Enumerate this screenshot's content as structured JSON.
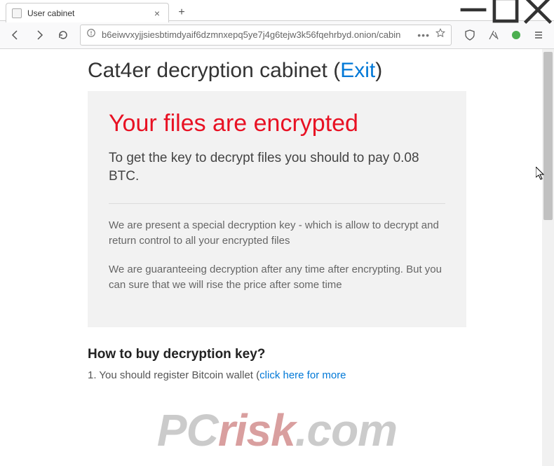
{
  "window": {
    "tab_title": "User cabinet",
    "url": "b6eiwvxyjjsiesbtimdyaif6dzmnxepq5ye7j4g6tejw3k56fqehrbyd.onion/cabin"
  },
  "page": {
    "title_prefix": "Cat4er decryption cabinet (",
    "exit_label": "Exit",
    "title_suffix": ")",
    "alert_heading": "Your files are encrypted",
    "alert_sub": "To get the key to decrypt files you should to pay 0.08 BTC.",
    "para1": "We are present a special decryption key - which is allow to decrypt and return control to all your encrypted files",
    "para2": "We are guaranteeing decryption after any time after encrypting. But you can sure that we will rise the price after some time",
    "howto_heading": "How to buy decryption key?",
    "step1_prefix": "1. You should register Bitcoin wallet (",
    "step1_link": "click here for more"
  },
  "watermark": {
    "left": "PC",
    "mid": "risk",
    "right": ".com"
  }
}
